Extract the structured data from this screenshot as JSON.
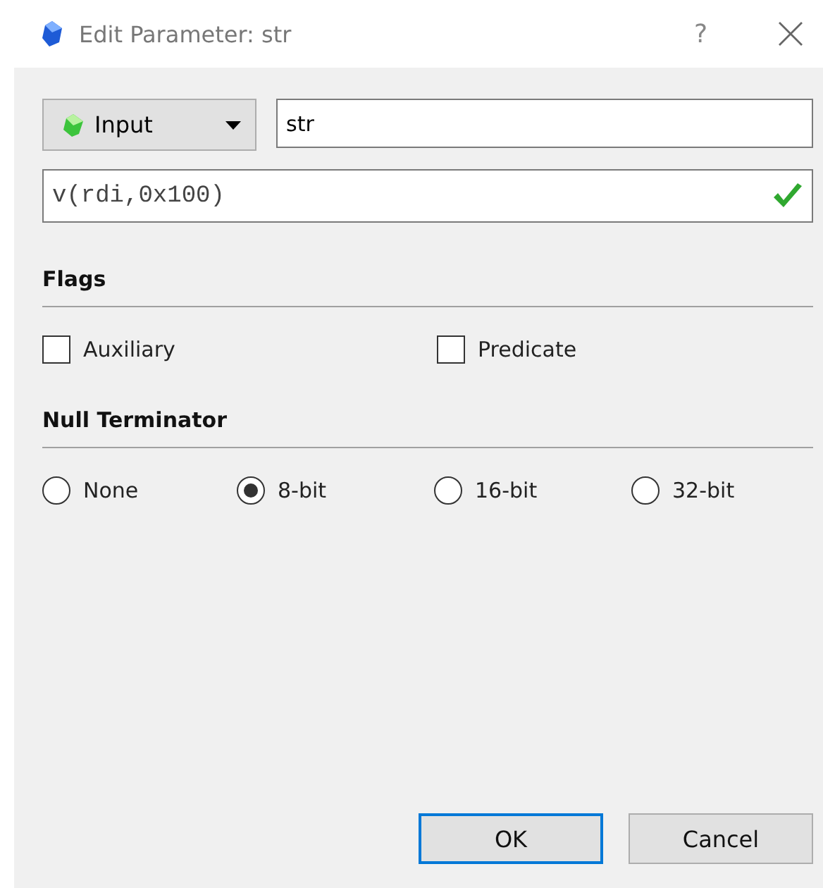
{
  "window": {
    "title": "Edit Parameter: str",
    "help": "?"
  },
  "direction": {
    "value": "Input"
  },
  "name_field": {
    "value": "str"
  },
  "expression_field": {
    "value": "v(rdi,0x100)",
    "valid": true
  },
  "flags": {
    "title": "Flags",
    "items": [
      {
        "label": "Auxiliary",
        "checked": false
      },
      {
        "label": "Predicate",
        "checked": false
      }
    ]
  },
  "null_terminator": {
    "title": "Null Terminator",
    "options": [
      {
        "label": "None",
        "selected": false
      },
      {
        "label": "8-bit",
        "selected": true
      },
      {
        "label": "16-bit",
        "selected": false
      },
      {
        "label": "32-bit",
        "selected": false
      }
    ]
  },
  "buttons": [
    {
      "label": "OK",
      "focused": true
    },
    {
      "label": "Cancel",
      "focused": false
    }
  ]
}
